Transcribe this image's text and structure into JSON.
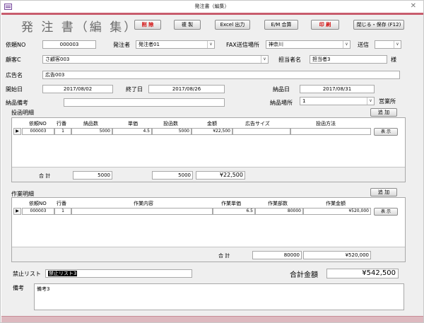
{
  "window": {
    "title": "発注書（編集）"
  },
  "header": {
    "title": "発 注 書（編 集）",
    "buttons": {
      "delete": "削 除",
      "copy": "複 製",
      "excel": "Excel 出力",
      "em": "E/M 合算",
      "print": "印 刷",
      "close_save": "閉じる・保存 (F12)"
    }
  },
  "form": {
    "request_no_label": "依頼NO",
    "request_no": "000003",
    "orderer_label": "発注者",
    "orderer": "発注者01",
    "fax_label": "FAX送信場所",
    "fax_place": "神奈川",
    "send_label": "送信",
    "send_value": "",
    "customer_label": "顧客C",
    "customer": "さ顧客003",
    "contact_label": "担当者名",
    "contact": "担当者3",
    "honorific": "様",
    "ad_name_label": "広告名",
    "ad_name": "広告003",
    "start_label": "開始日",
    "start_date": "2017/08/02",
    "end_label": "終了日",
    "end_date": "2017/08/26",
    "delivery_date_label": "納品日",
    "delivery_date": "2017/08/31",
    "delivery_note_label": "納品備考",
    "delivery_note": "",
    "delivery_place_label": "納品場所",
    "delivery_place": "1",
    "office_label": "営業所"
  },
  "placement": {
    "section_label": "投函明細",
    "add_button": "追 加",
    "columns": [
      "依頼NO",
      "行番",
      "納品数",
      "単価",
      "投函数",
      "金額",
      "広告サイズ",
      "投函方法"
    ],
    "rows": [
      {
        "request_no": "000003",
        "line": "1",
        "delivery_qty": "5000",
        "unit_price": "4.5",
        "post_qty": "5000",
        "amount": "¥22,500",
        "ad_size": "",
        "method": ""
      }
    ],
    "show_button": "表 示",
    "total_label": "合 計",
    "total_delivery_qty": "5000",
    "total_post_qty": "5000",
    "total_amount": "¥22,500"
  },
  "work": {
    "section_label": "作業明細",
    "add_button": "追 加",
    "columns": [
      "依頼NO",
      "行番",
      "作業内容",
      "作業単価",
      "作業部数",
      "作業金額"
    ],
    "rows": [
      {
        "request_no": "000003",
        "line": "1",
        "content": "",
        "unit_price": "6.5",
        "copies": "80000",
        "amount": "¥520,000"
      }
    ],
    "show_button": "表 示",
    "total_label": "合 計",
    "total_copies": "80000",
    "total_amount": "¥520,000"
  },
  "bottom": {
    "prohibited_label": "禁止リスト",
    "prohibited": "禁止リスト3",
    "grand_total_label": "合計金額",
    "grand_total": "¥542,500",
    "remarks_label": "備考",
    "remarks": "備考3"
  },
  "colors": {
    "accent_bar": "#c85c6d",
    "print_button_text": "#d10000",
    "prohibited_highlight": "#000000"
  }
}
